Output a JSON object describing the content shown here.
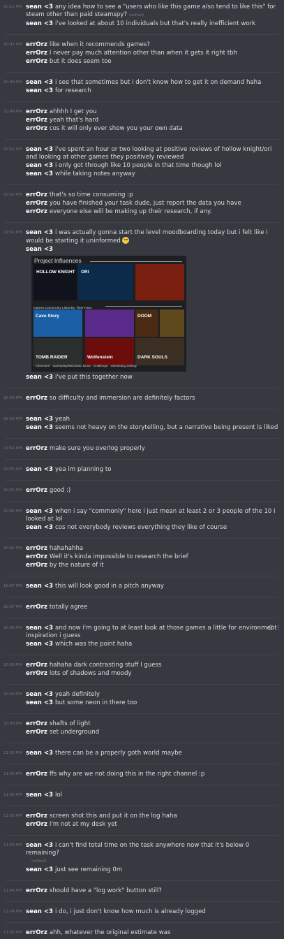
{
  "messages": [
    {
      "time": "10:12 PM",
      "lines": [
        {
          "author": "sean <3",
          "text": "any idea how to see a \"users who like this game also tend to like this\" for steam other than paid steamspy?",
          "edited": "(edited)"
        },
        {
          "author": "sean <3",
          "text": "i've looked at about 10 individuals but that's really inefficient work"
        }
      ]
    },
    {
      "time": "10:47 PM",
      "lines": [
        {
          "author": "errOrz",
          "text": "like when it recommends games?"
        },
        {
          "author": "errOrz",
          "text": "I never pay much attention other than when it gets it right tbh"
        },
        {
          "author": "errOrz",
          "text": "but it does seem too"
        }
      ]
    },
    {
      "time": "10:48 PM",
      "lines": [
        {
          "author": "sean <3",
          "text": "i see that sometimes but i don't know how to get it on demand haha"
        },
        {
          "author": "sean <3",
          "text": "for research"
        }
      ]
    },
    {
      "time": "10:48 PM",
      "lines": [
        {
          "author": "errOrz",
          "text": "ahhhh I get you"
        },
        {
          "author": "errOrz",
          "text": "yeah that's hard"
        },
        {
          "author": "errOrz",
          "text": "cos it will only ever show you your own data"
        }
      ]
    },
    {
      "time": "10:51 PM",
      "lines": [
        {
          "author": "sean <3",
          "text": "i've spent an hour or two looking at positive reviews of hollow knight/ori and looking at other games they positively reviewed"
        },
        {
          "author": "sean <3",
          "text": "i only got through like 10 people in that time though lol"
        },
        {
          "author": "sean <3",
          "text": "while taking notes anyway"
        }
      ]
    },
    {
      "time": "10:52 PM",
      "lines": [
        {
          "author": "errOrz",
          "text": "that's so time consuming :p"
        },
        {
          "author": "errOrz",
          "text": "you have finished your task dude, just report the data you have"
        },
        {
          "author": "errOrz",
          "text": "everyone else will be making up their research, if any."
        }
      ]
    },
    {
      "time": "10:52 PM",
      "lines": [
        {
          "author": "sean <3",
          "text": "i was actually gonna start the level moodboarding today but i felt like i would be starting it uninformed",
          "emoji": "person-shrugging-emoji"
        },
        {
          "author": "sean <3",
          "text": "",
          "attachment": true
        },
        {
          "author": "sean <3",
          "text": "i've put this together now"
        }
      ]
    },
    {
      "time": "10:53 PM",
      "lines": [
        {
          "author": "errOrz",
          "text": "so difficulty and immersion are definitely factors"
        }
      ]
    },
    {
      "time": "10:53 PM",
      "lines": [
        {
          "author": "sean <3",
          "text": "yeah"
        },
        {
          "author": "sean <3",
          "text": "seems not heavy on the storytelling, but a narrative being present is liked"
        }
      ]
    },
    {
      "time": "10:54 PM",
      "lines": [
        {
          "author": "errOrz",
          "text": "make sure you overlog properly"
        }
      ]
    },
    {
      "time": "10:55 PM",
      "lines": [
        {
          "author": "sean <3",
          "text": "yea im planning to"
        }
      ]
    },
    {
      "time": "10:55 PM",
      "lines": [
        {
          "author": "errOrz",
          "text": "good :)"
        }
      ]
    },
    {
      "time": "10:56 PM",
      "lines": [
        {
          "author": "sean <3",
          "text": "when i say \"commonly\" here i just mean at least 2 or 3 people of the 10 i looked at lol"
        },
        {
          "author": "sean <3",
          "text": "cos not everybody reviews everything they like of course"
        }
      ]
    },
    {
      "time": "10:56 PM",
      "lines": [
        {
          "author": "errOrz",
          "text": "hahahahha"
        },
        {
          "author": "errOrz",
          "text": "Well it's kinda impossible to research the brief"
        },
        {
          "author": "errOrz",
          "text": "by the nature of it"
        }
      ]
    },
    {
      "time": "10:57 PM",
      "lines": [
        {
          "author": "sean <3",
          "text": "this will look good in a pitch anyway"
        }
      ]
    },
    {
      "time": "10:57 PM",
      "lines": [
        {
          "author": "errOrz",
          "text": "totally agree"
        }
      ]
    },
    {
      "time": "10:58 PM",
      "hover": true,
      "lines": [
        {
          "author": "sean <3",
          "text": "and now i'm going to at least look at those games a little for environment inspiration i guess"
        },
        {
          "author": "sean <3",
          "text": "which was the point haha"
        }
      ]
    },
    {
      "time": "10:59 PM",
      "lines": [
        {
          "author": "errOrz",
          "text": "hahaha dark contrasting stuff I guess"
        },
        {
          "author": "errOrz",
          "text": "lots of shadows and moody"
        }
      ]
    },
    {
      "time": "10:59 PM",
      "lines": [
        {
          "author": "sean <3",
          "text": "yeah definitely"
        },
        {
          "author": "sean <3",
          "text": "but some neon in there too"
        }
      ]
    },
    {
      "time": "10:59 PM",
      "lines": [
        {
          "author": "errOrz",
          "text": "shafts of light"
        },
        {
          "author": "errOrz",
          "text": "set underground"
        }
      ]
    },
    {
      "time": "11:00 PM",
      "lines": [
        {
          "author": "sean <3",
          "text": "there can be a properly goth world maybe"
        }
      ]
    },
    {
      "time": "11:00 PM",
      "lines": [
        {
          "author": "errOrz",
          "text": "ffs why are we not doing this in the right channel :p"
        }
      ]
    },
    {
      "time": "11:00 PM",
      "lines": [
        {
          "author": "sean <3",
          "text": "lol"
        }
      ]
    },
    {
      "time": "11:00 PM",
      "lines": [
        {
          "author": "errOrz",
          "text": "screen shot this and put it on the log haha"
        },
        {
          "author": "errOrz",
          "text": "I'm not at my desk yet"
        }
      ]
    },
    {
      "time": "11:03 PM",
      "lines": [
        {
          "author": "sean <3",
          "text": "i can't find total time on the task anywhere now that it's below 0 remaining?",
          "edited_block": "(edited)"
        },
        {
          "author": "sean <3",
          "text": "just see remaining 0m"
        }
      ]
    },
    {
      "time": "11:04 PM",
      "lines": [
        {
          "author": "errOrz",
          "text": "should have a \"log work\" button still?"
        }
      ]
    },
    {
      "time": "11:04 PM",
      "lines": [
        {
          "author": "sean <3",
          "text": "i do, i just don't know how much is already logged"
        }
      ]
    },
    {
      "time": "11:05 PM",
      "lines": [
        {
          "author": "errOrz",
          "text": "ahh, whatever the original estimate was"
        }
      ]
    }
  ],
  "attachment": {
    "title": "Project Influences",
    "subtitle": "Games Commonly Liked By Their Fans",
    "tiles_top": [
      {
        "name": "hollow-knight",
        "label": "HOLLOW KNIGHT",
        "bg": "#10131c"
      },
      {
        "name": "ori",
        "label": "ORI",
        "bg": "#0c2b4a"
      },
      {
        "name": "super-metroid",
        "label": "",
        "bg": "#7a1e10"
      }
    ],
    "tiles_bottom": [
      {
        "name": "cave-story",
        "label": "Cave Story",
        "bg": "#1a5fa5"
      },
      {
        "name": "celeste",
        "label": "",
        "bg": "#5a2a8a"
      },
      {
        "name": "doom",
        "label": "DOOM",
        "bg": "#4a2a12"
      },
      {
        "name": "bioshock",
        "label": "",
        "bg": "#5e4a1c"
      },
      {
        "name": "tomb-raider",
        "label": "TOMB RAIDER",
        "bg": "#2a2f2e"
      },
      {
        "name": "wolfenstein",
        "label": "Wolfenstein",
        "bg": "#6b0d0d"
      },
      {
        "name": "dark-souls",
        "label": "DARK SOULS",
        "bg": "#3a2f22"
      }
    ],
    "footer": "- Adventure  - Gameplay/Mechanic focus  - Challenge  - Interesting Setting"
  }
}
